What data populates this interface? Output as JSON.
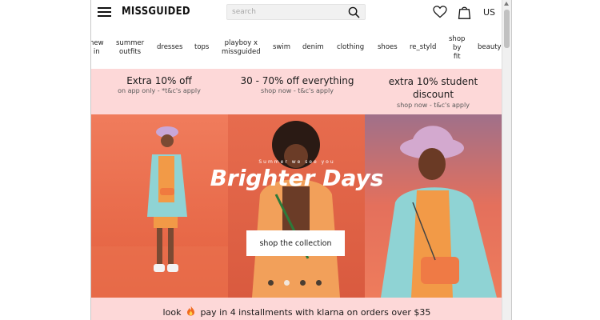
{
  "header": {
    "logo": "MISSGUIDED",
    "search_placeholder": "search",
    "region": "US"
  },
  "nav": {
    "items": [
      {
        "label": "new\nin"
      },
      {
        "label": "summer\noutfits"
      },
      {
        "label": "dresses"
      },
      {
        "label": "tops"
      },
      {
        "label": "playboy x\nmissguided"
      },
      {
        "label": "swim"
      },
      {
        "label": "denim"
      },
      {
        "label": "clothing"
      },
      {
        "label": "shoes"
      },
      {
        "label": "re_styld"
      },
      {
        "label": "shop\nby\nfit"
      },
      {
        "label": "beauty"
      }
    ]
  },
  "promos": [
    {
      "title": "Extra 10% off",
      "sub": "on app only - *t&c's apply"
    },
    {
      "title": "30 - 70% off everything",
      "sub": "shop now - t&c's apply"
    },
    {
      "title": "extra 10% student\ndiscount",
      "sub": "shop now - t&c's apply"
    }
  ],
  "hero": {
    "eyebrow": "Summer we see you",
    "title": "Brighter Days",
    "cta_label": "shop the collection",
    "slides_total": 4,
    "active_slide": 2
  },
  "klarna": {
    "before": "look",
    "after": "pay in 4 installments with klarna on orders over $35"
  },
  "colors": {
    "promo_bg": "#fdd8d8",
    "hero_coral": "#e86a4e"
  }
}
